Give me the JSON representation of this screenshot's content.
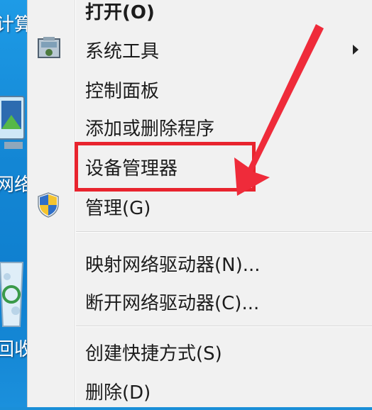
{
  "desktop": {
    "labels": [
      "计算",
      "网络",
      "回收"
    ]
  },
  "menu": {
    "items": [
      {
        "label": "打开(O)",
        "bold": true
      },
      {
        "label": "系统工具",
        "has_submenu": true,
        "icon": "system-tools-icon"
      },
      {
        "label": "控制面板"
      },
      {
        "label": "添加或删除程序"
      },
      {
        "label": "设备管理器",
        "highlighted": true
      },
      {
        "label": "管理(G)",
        "icon": "uac-shield-icon"
      },
      {
        "label": "映射网络驱动器(N)..."
      },
      {
        "label": "断开网络驱动器(C)..."
      },
      {
        "label": "创建快捷方式(S)"
      },
      {
        "label": "删除(D)"
      }
    ]
  },
  "annotation": {
    "box_color": "#e8242e",
    "arrow_color": "#e8242e"
  }
}
